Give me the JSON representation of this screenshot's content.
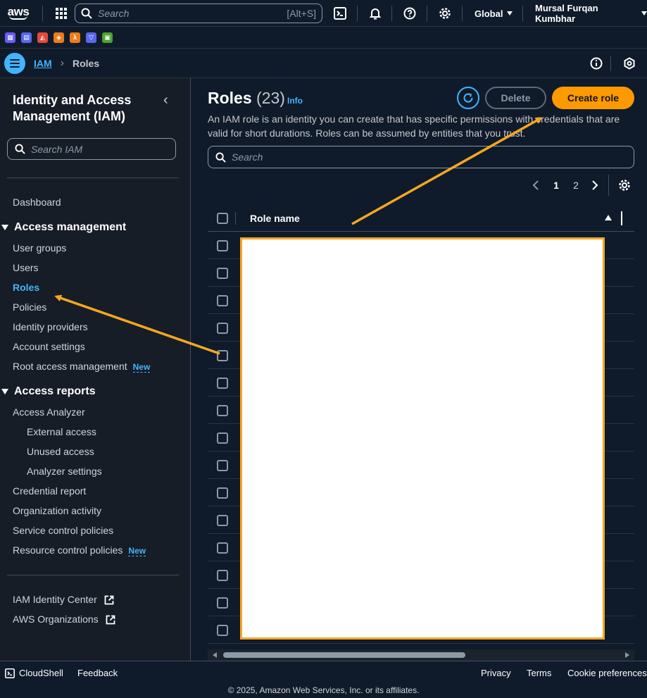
{
  "topnav": {
    "logo_text": "aws",
    "search_placeholder": "Search",
    "search_shortcut": "[Alt+S]",
    "region": "Global",
    "user": "Mursal Furqan Kumbhar"
  },
  "favorites": [
    {
      "icon": "ec2-icon",
      "color": "#6b5cf6"
    },
    {
      "icon": "database-icon",
      "color": "#5a67f0"
    },
    {
      "icon": "alarm-icon",
      "color": "#e7483a"
    },
    {
      "icon": "shapes-icon",
      "color": "#ed7b1a"
    },
    {
      "icon": "lambda-icon",
      "color": "#ed7b1a"
    },
    {
      "icon": "bucket-icon",
      "color": "#5a67f0"
    },
    {
      "icon": "storage-icon",
      "color": "#4aa32f"
    }
  ],
  "breadcrumb": {
    "parent": "IAM",
    "current": "Roles"
  },
  "sidebar": {
    "title": "Identity and Access Management (IAM)",
    "search_placeholder": "Search IAM",
    "dashboard": "Dashboard",
    "access_management": {
      "label": "Access management",
      "items": [
        "User groups",
        "Users",
        "Roles",
        "Policies",
        "Identity providers",
        "Account settings",
        "Root access management"
      ],
      "new_badge": "New"
    },
    "access_reports": {
      "label": "Access reports",
      "analyzer": "Access Analyzer",
      "sub_items": [
        "External access",
        "Unused access",
        "Analyzer settings"
      ],
      "items": [
        "Credential report",
        "Organization activity",
        "Service control policies",
        "Resource control policies"
      ],
      "new_badge": "New"
    },
    "links": [
      "IAM Identity Center",
      "AWS Organizations"
    ]
  },
  "main": {
    "title": "Roles",
    "count": "(23)",
    "info": "Info",
    "delete": "Delete",
    "create": "Create role",
    "description": "An IAM role is an identity you can create that has specific permissions with credentials that are valid for short durations. Roles can be assumed by entities that you trust.",
    "search_placeholder": "Search",
    "pages": [
      "1",
      "2"
    ],
    "current_page": "1",
    "column_header": "Role name",
    "row_count": 15
  },
  "footer": {
    "cloudshell": "CloudShell",
    "feedback": "Feedback",
    "privacy": "Privacy",
    "terms": "Terms",
    "cookies": "Cookie preferences",
    "copyright": "© 2025, Amazon Web Services, Inc. or its affiliates."
  },
  "colors": {
    "accent": "#42b4ff",
    "primary_button": "#ff9900",
    "annotation": "#f5a623"
  }
}
